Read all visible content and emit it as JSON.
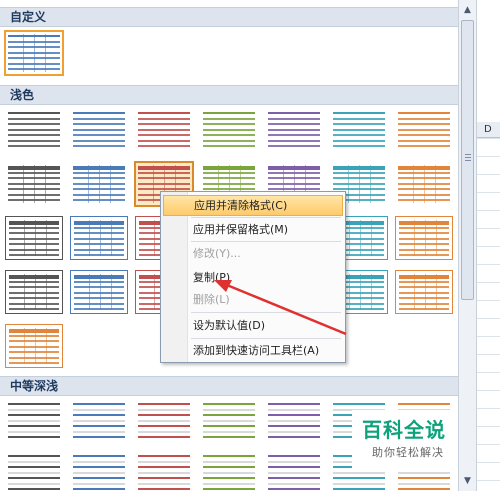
{
  "sections": [
    {
      "id": "custom",
      "label": "自定义"
    },
    {
      "id": "light",
      "label": "浅色"
    },
    {
      "id": "medium",
      "label": "中等深浅"
    }
  ],
  "context_menu": {
    "items": [
      {
        "label": "应用并清除格式(C)",
        "state": "hover"
      },
      {
        "label": "应用并保留格式(M)",
        "state": "normal"
      },
      {
        "label": "修改(Y)...",
        "state": "disabled"
      },
      {
        "label": "复制(P)",
        "state": "normal"
      },
      {
        "label": "删除(L)",
        "state": "disabled"
      },
      {
        "label": "设为默认值(D)",
        "state": "normal"
      },
      {
        "label": "添加到快速访问工具栏(A)",
        "state": "normal"
      }
    ]
  },
  "sheet": {
    "column_letter": "D"
  },
  "watermark": {
    "title": "百科全说",
    "subtitle": "助你轻松解决"
  },
  "colors": {
    "light_styles": [
      "#555555",
      "#4a7ab8",
      "#c0504d",
      "#7aa43c",
      "#7d5ea8",
      "#3ba3b8",
      "#e0853a"
    ],
    "arrow": "#e03030",
    "hover_fill": "#fdca6a"
  }
}
